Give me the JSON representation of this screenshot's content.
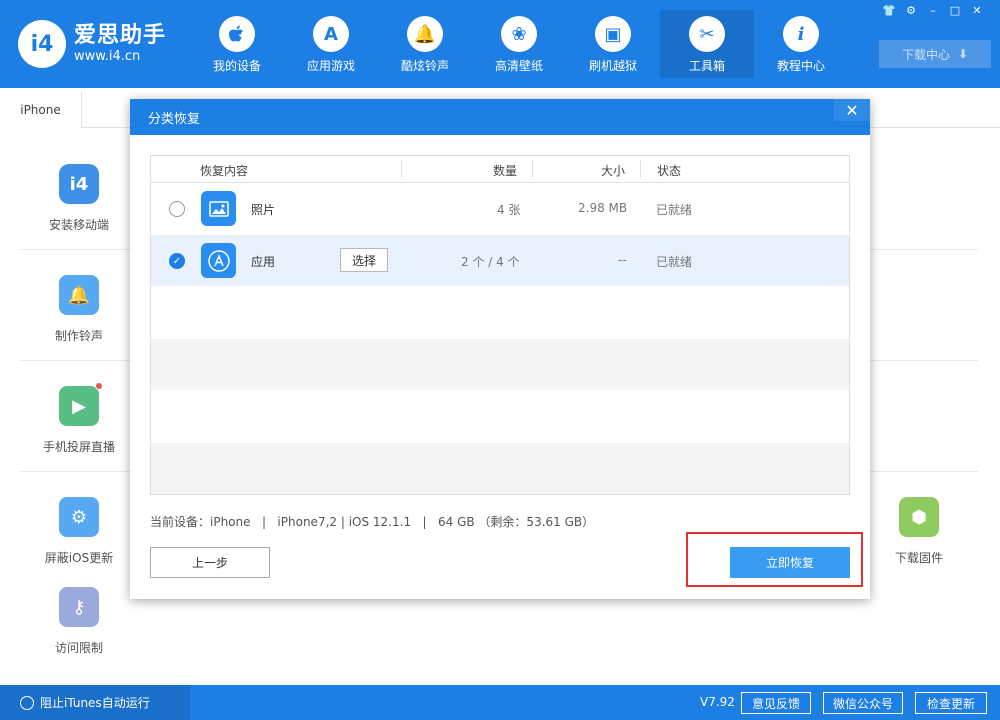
{
  "header": {
    "logo_mark": "i4",
    "logo_name": "爱思助手",
    "logo_url": "www.i4.cn",
    "nav": [
      {
        "label": "我的设备",
        "icon": "apple-icon",
        "glyph": "",
        "active": false
      },
      {
        "label": "应用游戏",
        "icon": "app-store-icon",
        "glyph": "A",
        "active": false
      },
      {
        "label": "酷炫铃声",
        "icon": "bell-icon",
        "glyph": "🔔",
        "active": false
      },
      {
        "label": "高清壁纸",
        "icon": "flower-icon",
        "glyph": "❀",
        "active": false
      },
      {
        "label": "刷机越狱",
        "icon": "box-icon",
        "glyph": "▣",
        "active": false
      },
      {
        "label": "工具箱",
        "icon": "tools-icon",
        "glyph": "✂",
        "active": true
      },
      {
        "label": "教程中心",
        "icon": "info-icon",
        "glyph": "i",
        "active": false
      }
    ],
    "window_buttons": [
      "👕",
      "⚙",
      "–",
      "□",
      "✕"
    ],
    "download_center": "下载中心",
    "download_glyph": "⬇"
  },
  "device_tab": "iPhone",
  "tools": [
    {
      "label": "安装移动端",
      "icon": "i4-app-icon",
      "glyph": "i4",
      "color": "#1d7ee3"
    },
    {
      "label": "制作铃声",
      "icon": "bell-plus-icon",
      "glyph": "🔔",
      "color": "#3a9bf2"
    },
    {
      "label": "手机投屏直播",
      "icon": "screen-cast-icon",
      "glyph": "▶",
      "color": "#3cb371"
    },
    {
      "label": "屏蔽iOS更新",
      "icon": "gear-block-icon",
      "glyph": "⚙",
      "color": "#3a9bf2"
    },
    {
      "label": "访问限制",
      "icon": "key-icon",
      "glyph": "⚷",
      "color": "#8a9bd6"
    },
    {
      "label": "下载固件",
      "icon": "cube-icon",
      "glyph": "⬢",
      "color": "#7cc243"
    }
  ],
  "footer": {
    "itunes_label": "阻止iTunes自动运行",
    "version": "V7.92",
    "feedback": "意见反馈",
    "wechat": "微信公众号",
    "check_update": "检查更新"
  },
  "modal": {
    "title": "分类恢复",
    "close": "✕",
    "columns": {
      "content": "恢复内容",
      "count": "数量",
      "size": "大小",
      "status": "状态"
    },
    "rows": [
      {
        "name": "照片",
        "icon": "photo-icon",
        "glyph": "▣",
        "count": "4 张",
        "size": "2.98 MB",
        "status": "已就绪",
        "checked": false
      },
      {
        "name": "应用",
        "icon": "app-store-icon",
        "glyph": "A",
        "choose": "选择",
        "count": "2 个 / 4 个",
        "size": "--",
        "status": "已就绪",
        "checked": true
      }
    ],
    "device_info": "当前设备：iPhone   |   iPhone7,2 | iOS 12.1.1   |   64 GB （剩余：53.61 GB）",
    "prev_button": "上一步",
    "restore_button": "立即恢复"
  }
}
